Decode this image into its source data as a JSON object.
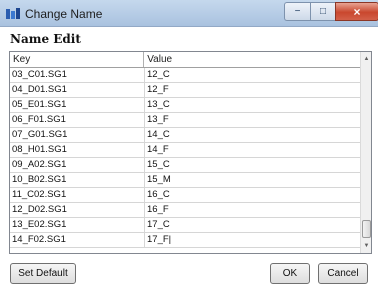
{
  "window": {
    "title": "Change Name",
    "icon": "app-icon",
    "controls": {
      "minimize": "−",
      "maximize": "□",
      "close": "×"
    }
  },
  "panel": {
    "heading": "Name Edit"
  },
  "table": {
    "columns": [
      "Key",
      "Value"
    ],
    "rows": [
      {
        "key": "03_C01.SG1",
        "value": "12_C"
      },
      {
        "key": "04_D01.SG1",
        "value": "12_F"
      },
      {
        "key": "05_E01.SG1",
        "value": "13_C"
      },
      {
        "key": "06_F01.SG1",
        "value": "13_F"
      },
      {
        "key": "07_G01.SG1",
        "value": "14_C"
      },
      {
        "key": "08_H01.SG1",
        "value": "14_F"
      },
      {
        "key": "09_A02.SG1",
        "value": "15_C"
      },
      {
        "key": "10_B02.SG1",
        "value": "15_M"
      },
      {
        "key": "11_C02.SG1",
        "value": "16_C"
      },
      {
        "key": "12_D02.SG1",
        "value": "16_F"
      },
      {
        "key": "13_E02.SG1",
        "value": "17_C"
      },
      {
        "key": "14_F02.SG1",
        "value": "17_F|"
      }
    ]
  },
  "buttons": {
    "set_default": "Set Default",
    "ok": "OK",
    "cancel": "Cancel"
  }
}
